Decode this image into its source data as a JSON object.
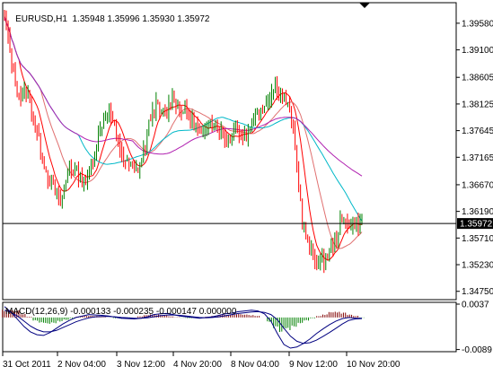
{
  "chart_data": [
    {
      "type": "candlestick",
      "title": "EURUSD,H1",
      "ohlc": {
        "open": "1.35948",
        "high": "1.35996",
        "low": "1.35930",
        "close": "1.35972"
      },
      "current_price": 1.35972,
      "current_price_label": "1.35972",
      "y_ticks": [
        "1.39580",
        "1.39100",
        "1.38605",
        "1.38125",
        "1.37645",
        "1.37165",
        "1.36670",
        "1.36190",
        "1.35710",
        "1.35230",
        "1.34750"
      ],
      "ylim": [
        1.346,
        1.3995
      ],
      "x_ticks": [
        "31 Oct 2011",
        "2 Nov 04:00",
        "3 Nov 12:00",
        "4 Nov 20:00",
        "8 Nov 04:00",
        "9 Nov 12:00",
        "10 Nov 20:00"
      ],
      "close_path": [
        1.3965,
        1.391,
        1.385,
        1.3825,
        1.384,
        1.3805,
        1.376,
        1.372,
        1.368,
        1.366,
        1.3635,
        1.3655,
        1.37,
        1.369,
        1.368,
        1.367,
        1.37,
        1.374,
        1.378,
        1.38,
        1.378,
        1.374,
        1.3715,
        1.37,
        1.369,
        1.37,
        1.374,
        1.379,
        1.381,
        1.379,
        1.38,
        1.383,
        1.381,
        1.38,
        1.379,
        1.378,
        1.376,
        1.3755,
        1.379,
        1.378,
        1.376,
        1.3745,
        1.376,
        1.377,
        1.3755,
        1.376,
        1.379,
        1.38,
        1.381,
        1.383,
        1.3845,
        1.3835,
        1.3815,
        1.379,
        1.37,
        1.36,
        1.356,
        1.354,
        1.3525,
        1.353,
        1.3545,
        1.3565,
        1.3595,
        1.3605,
        1.359,
        1.36,
        1.3597
      ],
      "series": [
        {
          "color": "#ff0000",
          "period": 3
        },
        {
          "color": "#e07070",
          "period": 7
        },
        {
          "color": "#00b8c8",
          "period": 14
        },
        {
          "color": "#b020b0",
          "period": 24
        }
      ],
      "colors": {
        "bull": "#008000",
        "bear": "#ff0000",
        "macd_pos": "#800000",
        "macd_neg": "#008000",
        "macd_line": "#000080"
      }
    },
    {
      "type": "bar",
      "title": "MACD(12,26,9) -0.000133 -0.000235 -0.000147 0.000000",
      "y_ticks": [
        "0.0037",
        "-0.0089"
      ],
      "ylim": [
        -0.0095,
        0.0042
      ],
      "histogram": [
        0.002,
        0.0022,
        0.0018,
        0.001,
        0.0002,
        -0.0008,
        -0.0014,
        -0.0016,
        -0.0014,
        -0.001,
        -0.0006,
        -0.0002,
        0.0002,
        0.0004,
        0.0005,
        0.0004,
        0.0002,
        0.0,
        -0.0002,
        -0.0003,
        -0.0002,
        0.0,
        0.0003,
        0.0006,
        0.0008,
        0.0007,
        0.0005,
        0.0003,
        0.0001,
        -0.0001,
        -0.0002,
        -0.0001,
        0.0,
        0.0002,
        0.0004,
        0.0006,
        0.0007,
        0.0008,
        0.0009,
        0.0008,
        0.0006,
        0.0004,
        0.0,
        -0.0012,
        -0.0028,
        -0.0036,
        -0.0032,
        -0.0024,
        -0.0016,
        -0.0008,
        -0.0002,
        0.0004,
        0.0008,
        0.0014,
        0.0016,
        0.0012,
        0.0008,
        0.0004,
        -0.0001
      ],
      "macd_line": [
        0.003,
        0.0015,
        -0.0005,
        -0.0025,
        -0.004,
        -0.0048,
        -0.005,
        -0.0042,
        -0.003,
        -0.0018,
        -0.0008,
        0.0,
        0.0004,
        0.0008,
        0.0007,
        0.0006,
        0.0004,
        0.0001,
        -0.0002,
        -0.0003,
        -0.0004,
        -0.0002,
        0.0002,
        0.0008,
        0.001,
        0.0011,
        0.0008,
        0.0004,
        0.0002,
        0.0,
        -0.0002,
        0.0,
        0.0002,
        0.0006,
        0.001,
        0.0012,
        0.0016,
        0.0018,
        0.002,
        0.0018,
        0.001,
        -0.001,
        -0.0045,
        -0.0075,
        -0.0085,
        -0.0082,
        -0.0072,
        -0.006,
        -0.0045,
        -0.0032,
        -0.002,
        -0.001,
        -0.0003,
        0.0,
        -0.0002,
        -0.0002
      ],
      "signal_line": [
        0.002,
        0.0014,
        0.0004,
        -0.001,
        -0.0024,
        -0.0034,
        -0.004,
        -0.004,
        -0.0036,
        -0.0028,
        -0.002,
        -0.0012,
        -0.0006,
        -0.0001,
        0.0002,
        0.0003,
        0.0003,
        0.0002,
        0.0,
        -0.0001,
        -0.0002,
        -0.0002,
        -0.0001,
        0.0002,
        0.0005,
        0.0007,
        0.0007,
        0.0006,
        0.0004,
        0.0002,
        0.0,
        -0.0001,
        0.0,
        0.0002,
        0.0005,
        0.0008,
        0.0011,
        0.0013,
        0.0015,
        0.0016,
        0.0014,
        0.0008,
        -0.0006,
        -0.003,
        -0.0052,
        -0.0066,
        -0.0072,
        -0.007,
        -0.0063,
        -0.0053,
        -0.0042,
        -0.003,
        -0.0018,
        -0.0008,
        -0.0004,
        -0.0003
      ]
    }
  ]
}
